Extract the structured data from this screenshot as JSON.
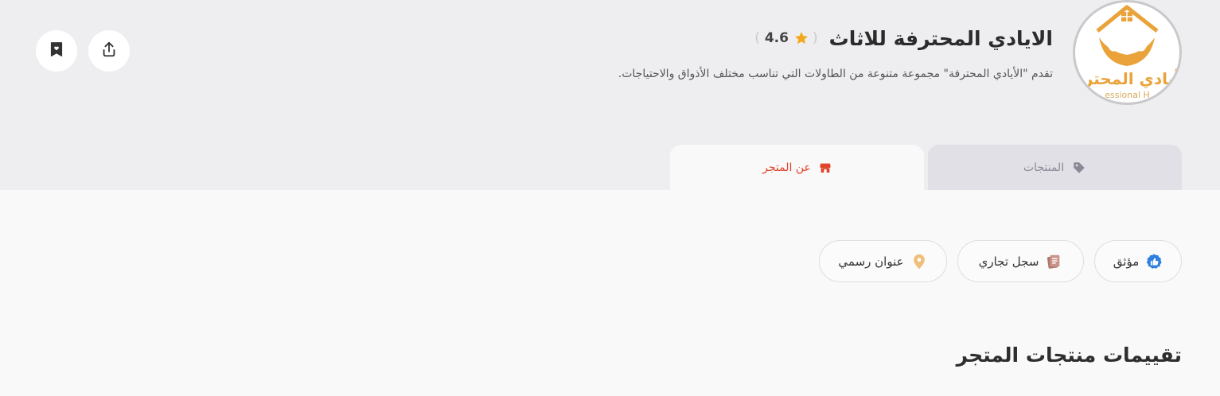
{
  "store": {
    "name": "الايادي المحترفة للاثاث",
    "rating": "4.6",
    "paren_open": "(",
    "paren_close": ")",
    "description": "تقدم \"الأيادي المحترفة\" مجموعة متنوعة من الطاولات التي تناسب مختلف الأذواق والاحتياجات.",
    "logo_text": "أيادي المحترفة",
    "logo_subtext": "essional H"
  },
  "tabs": [
    {
      "label": "المنتجات",
      "icon": "tag-icon",
      "active": false
    },
    {
      "label": "عن المتجر",
      "icon": "store-icon",
      "active": true
    }
  ],
  "badges": [
    {
      "label": "مؤثق",
      "icon": "thumbs-up-icon",
      "color": "#2f7fe0"
    },
    {
      "label": "سجل تجاري",
      "icon": "document-icon",
      "color": "#b0766a"
    },
    {
      "label": "عنوان رسمي",
      "icon": "location-pin-icon",
      "color": "#efc07a"
    }
  ],
  "section": {
    "title": "تقييمات منتجات المتجر"
  },
  "actions": {
    "share_icon": "share-icon",
    "bookmark_icon": "bookmark-heart-icon"
  },
  "colors": {
    "accent": "#e0442a",
    "star": "#f2a81d",
    "logo_orange": "#e9a33a",
    "header_bg": "#eeeef1"
  }
}
